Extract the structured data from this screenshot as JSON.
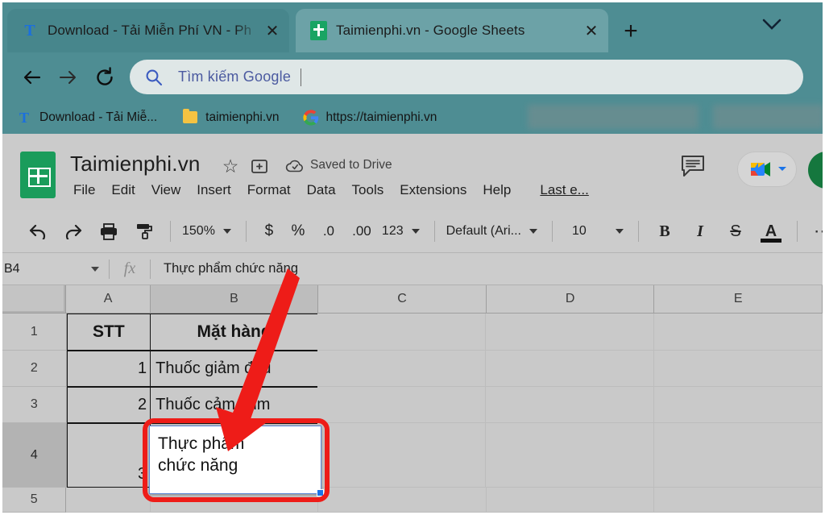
{
  "browser": {
    "tabs": [
      {
        "title": "Download - Tải Miễn Phí VN - Ph",
        "favicon": "letter-t-icon",
        "active": false,
        "close_label": "✕"
      },
      {
        "title": "Taimienphi.vn - Google Sheets",
        "favicon": "google-sheets-icon",
        "active": true,
        "close_label": "✕"
      }
    ],
    "new_tab_label": "+",
    "window_chevron": "chevron-down-icon",
    "nav": {
      "back": "back-arrow-icon",
      "forward": "forward-arrow-icon",
      "reload": "reload-icon"
    },
    "omnibox": {
      "icon": "search-icon",
      "value": "Tìm kiếm Google",
      "placeholder": "Tìm kiếm Google"
    },
    "bookmarks": [
      {
        "label": "Download - Tải Miễ...",
        "icon": "letter-t-icon"
      },
      {
        "label": "taimienphi.vn",
        "icon": "folder-icon"
      },
      {
        "label": "https://taimienphi.vn",
        "icon": "google-icon"
      }
    ]
  },
  "sheets": {
    "logo": "google-sheets-logo",
    "doc_title": "Taimienphi.vn",
    "star_icon": "star-icon",
    "move_icon": "move-to-folder-icon",
    "cloud_icon": "cloud-icon",
    "save_status": "Saved to Drive",
    "menu": [
      "File",
      "Edit",
      "View",
      "Insert",
      "Format",
      "Data",
      "Tools",
      "Extensions",
      "Help"
    ],
    "last_edit": "Last e...",
    "comment_icon": "comment-icon",
    "meet_icon": "google-meet-icon",
    "meet_caret": "chevron-down-icon",
    "share_button": "share-button",
    "toolbar": {
      "undo": "undo-icon",
      "redo": "redo-icon",
      "print": "print-icon",
      "paint": "paint-format-icon",
      "zoom": "150%",
      "currency": "$",
      "percent": "%",
      "decrease_decimal": ".0",
      "increase_decimal": ".00",
      "more_formats": "123",
      "font": "Default (Ari...",
      "font_size": "10",
      "bold": "B",
      "italic": "I",
      "strikethrough": "S",
      "text_color": "A",
      "more": "⋯"
    },
    "formula_bar": {
      "name_box": "B4",
      "fx": "fx",
      "value": "Thực phẩm chức năng"
    },
    "grid": {
      "columns": [
        "A",
        "B",
        "C",
        "D",
        "E"
      ],
      "rows": [
        "1",
        "2",
        "3",
        "4",
        "5"
      ],
      "cells": {
        "A1": "STT",
        "B1": "Mặt hàng",
        "A2": "1",
        "B2": "Thuốc giảm đau",
        "A3": "2",
        "B3": "Thuốc cảm cúm",
        "A4": "3",
        "B4": ""
      },
      "selected_cell": "B4",
      "editing_text": "Thực phẩm\nchức năng"
    }
  },
  "annotation": {
    "highlight_color": "#ee1c18",
    "arrow_color": "#ee1c18",
    "target_cell": "B4"
  }
}
